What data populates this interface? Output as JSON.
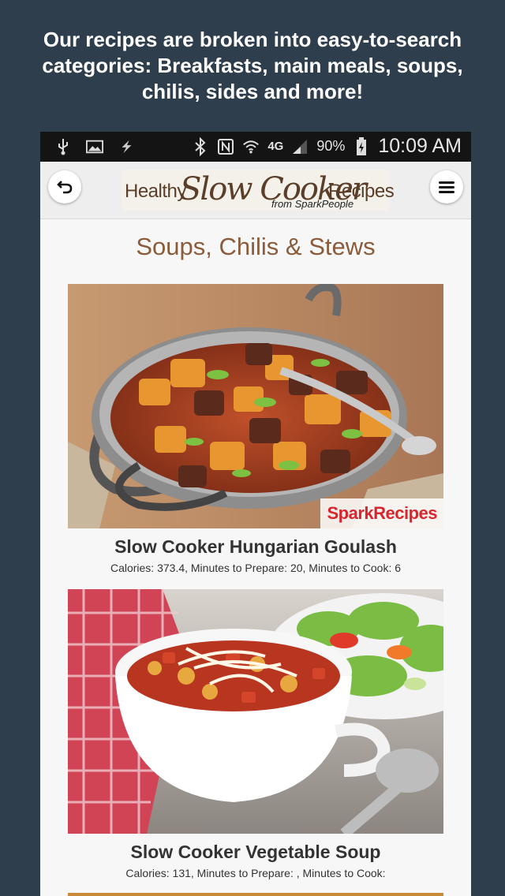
{
  "promo_text": "Our recipes are broken into easy-to-search categories: Breakfasts, main meals, soups, chilis, sides and more!",
  "status_bar": {
    "battery_percent": "90%",
    "time": "10:09 AM",
    "network": "4G",
    "icons": [
      "usb-icon",
      "image-icon",
      "flash-icon",
      "bluetooth-icon",
      "nfc-icon",
      "wifi-icon",
      "signal-icon",
      "battery-icon"
    ]
  },
  "app": {
    "logo": {
      "healthy": "Healthy",
      "slow_cooker": "Slow Cooker",
      "recipes": "Recipes",
      "from": "from SparkPeople"
    },
    "section_title": "Soups, Chilis & Stews"
  },
  "recipes": [
    {
      "title": "Slow Cooker Hungarian Goulash",
      "meta": "Calories: 373.4, Minutes to Prepare: 20, Minutes to Cook: 6",
      "watermark": "SparkRecipes"
    },
    {
      "title": "Slow Cooker Vegetable Soup",
      "meta": "Calories: 131, Minutes to Prepare: , Minutes to Cook:"
    }
  ],
  "colors": {
    "background": "#2e3e4d",
    "title_brown": "#8a5c3b",
    "logo_brown": "#5b3e2a"
  }
}
